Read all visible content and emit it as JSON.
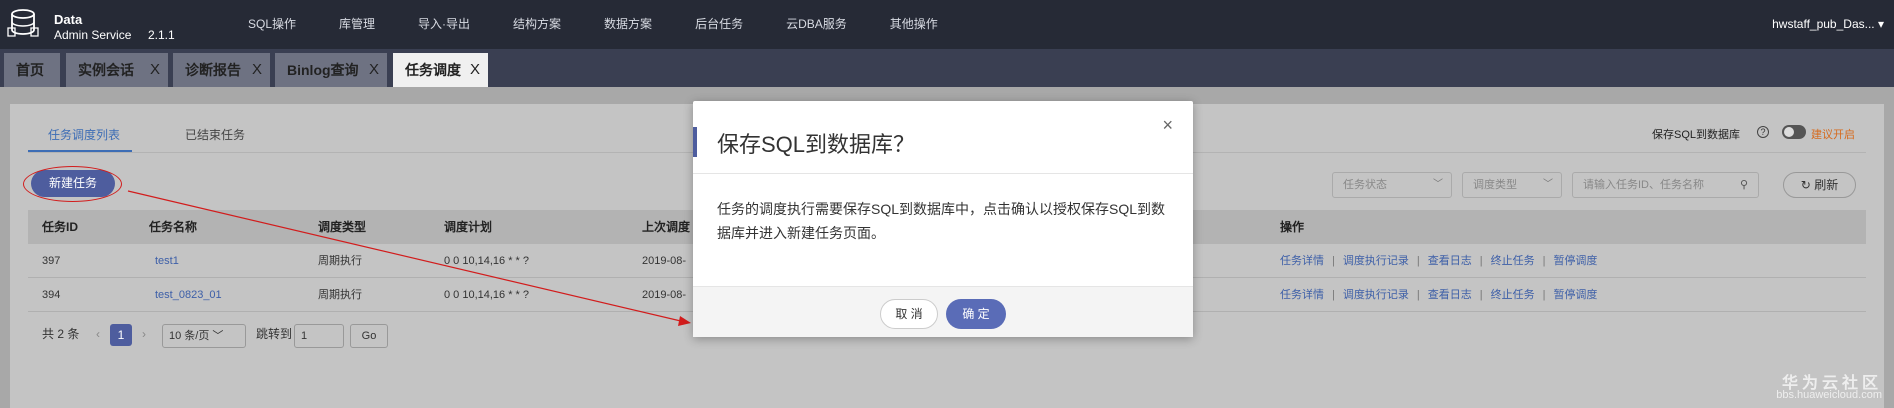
{
  "app": {
    "brand_line1": "Data",
    "brand_line2": "Admin Service",
    "version": "2.1.1"
  },
  "topnav": [
    "SQL操作",
    "库管理",
    "导入·导出",
    "结构方案",
    "数据方案",
    "后台任务",
    "云DBA服务",
    "其他操作"
  ],
  "user": "hwstaff_pub_Das...",
  "tabs": [
    {
      "label": "首页",
      "closable": false
    },
    {
      "label": "实例会话",
      "closable": true
    },
    {
      "label": "诊断报告",
      "closable": true
    },
    {
      "label": "Binlog查询",
      "closable": true
    },
    {
      "label": "任务调度",
      "closable": true,
      "active": true
    }
  ],
  "subtabs": [
    "任务调度列表",
    "已结束任务"
  ],
  "new_task": "新建任务",
  "save_sql_label": "保存SQL到数据库",
  "suggest_label": "建议开启",
  "filters": {
    "status_placeholder": "任务状态",
    "type_placeholder": "调度类型",
    "search_placeholder": "请输入任务ID、任务名称",
    "refresh_label": "刷新"
  },
  "table": {
    "headers": [
      "任务ID",
      "任务名称",
      "调度类型",
      "调度计划",
      "上次调度",
      "操作"
    ],
    "rows": [
      {
        "id": "397",
        "name": "test1",
        "type": "周期执行",
        "plan": "0 0 10,14,16 * * ?",
        "last": "2019-08-"
      },
      {
        "id": "394",
        "name": "test_0823_01",
        "type": "周期执行",
        "plan": "0 0 10,14,16 * * ?",
        "last": "2019-08-"
      }
    ],
    "ops": [
      "任务详情",
      "调度执行记录",
      "查看日志",
      "终止任务",
      "暂停调度"
    ]
  },
  "pager": {
    "total": "共 2 条",
    "current_page": "1",
    "page_size": "10 条/页",
    "jump_label": "跳转到",
    "jump_value": "1",
    "go_label": "Go"
  },
  "modal": {
    "title": "保存SQL到数据库？",
    "body": "任务的调度执行需要保存SQL到数据库中，点击确认以授权保存SQL到数据库并进入新建任务页面。",
    "cancel": "取 消",
    "ok": "确 定"
  },
  "watermark": {
    "line1": "华为云社区",
    "line2": "bbs.huaweicloud.com"
  },
  "colors": {
    "accent": "#4e5d9e",
    "annotation": "#d21c1c",
    "topbar": "#262a36"
  }
}
